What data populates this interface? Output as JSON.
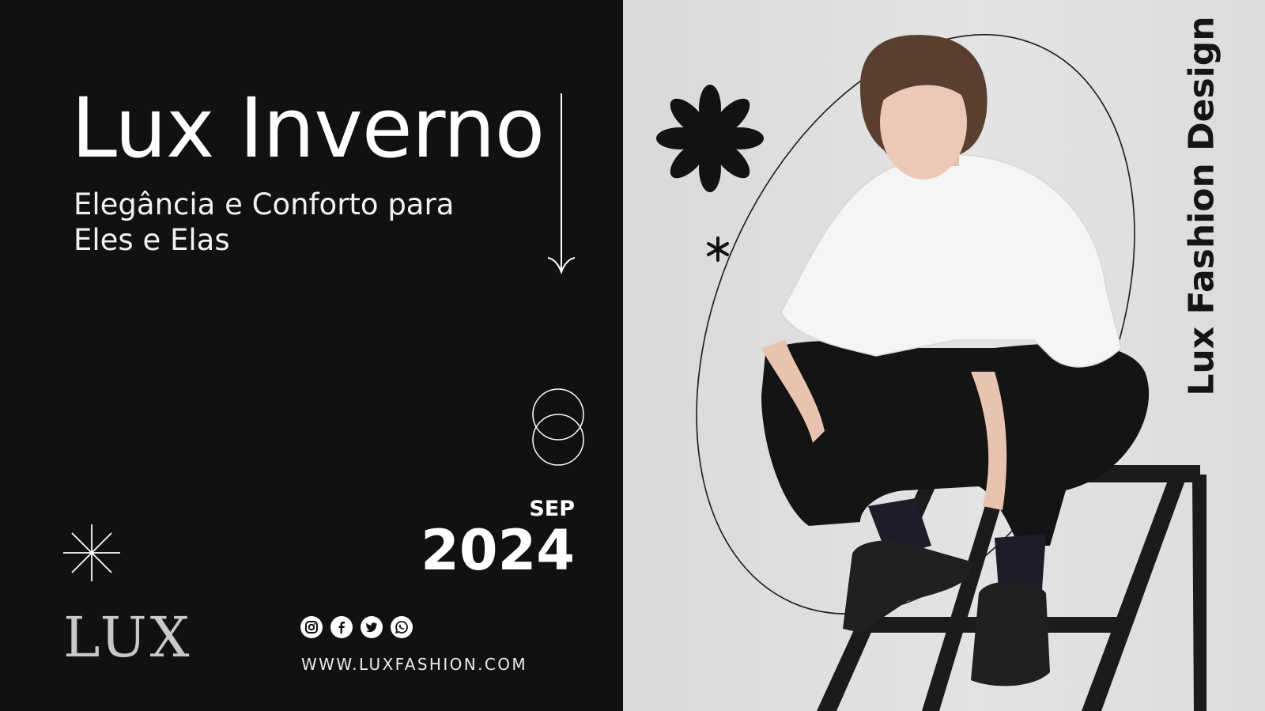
{
  "hero": {
    "title": "Lux Inverno",
    "subtitle": "Elegância e Conforto para Eles e Elas"
  },
  "date": {
    "month": "SEP",
    "year": "2024"
  },
  "brand": {
    "logo_text": "LUX",
    "vertical_text": "Lux Fashion Design"
  },
  "contact": {
    "website": "WWW.LUXFASHION.COM"
  },
  "social_icons": [
    "instagram-icon",
    "facebook-icon",
    "twitter-icon",
    "whatsapp-icon"
  ],
  "colors": {
    "background_dark": "#111111",
    "background_light": "#e0e0e0",
    "text_light": "#ffffff",
    "text_dark": "#151515"
  }
}
